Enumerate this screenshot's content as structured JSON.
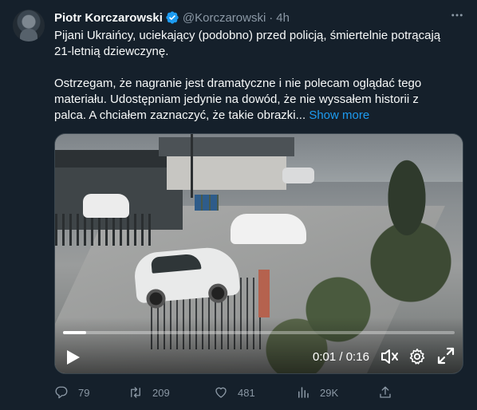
{
  "tweet": {
    "author_name": "Piotr Korczarowski",
    "handle": "@Korczarowski",
    "separator": "·",
    "time": "4h",
    "more_icon": "ellipsis-icon",
    "verified": true,
    "paragraph1": "Pijani Ukraińcy, uciekający (podobno) przed policją, śmiertelnie potrącają 21-letnią dziewczynę.",
    "paragraph2": "Ostrzegam, że nagranie jest dramatyczne i nie polecam oglądać tego materiału. Udostępniam jedynie na dowód, że nie wyssałem historii z palca. A chciałem zaznaczyć, że takie obrazki...",
    "show_more": "Show more"
  },
  "video": {
    "current_time": "0:01",
    "separator": " / ",
    "duration": "0:16",
    "progress": 0.06
  },
  "actions": {
    "replies": "79",
    "retweets": "209",
    "likes": "481",
    "views": "29K"
  },
  "colors": {
    "background": "#15202b",
    "accent": "#1d9bf0",
    "muted": "#8b98a5",
    "text": "#f7f9f9"
  }
}
